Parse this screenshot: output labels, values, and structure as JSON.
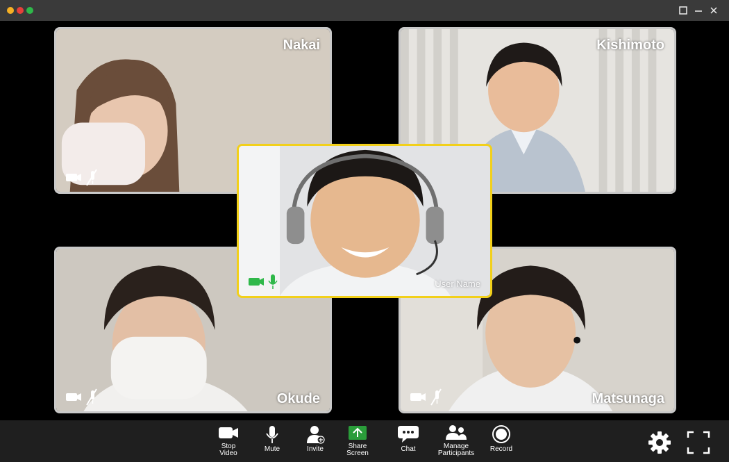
{
  "window": {
    "traffic_lights": [
      "#f6b024",
      "#e6403a",
      "#2fb84a"
    ]
  },
  "participants": {
    "nakai": {
      "name": "Nakai",
      "video": "off",
      "mic": "muted"
    },
    "kishimoto": {
      "name": "Kishimoto"
    },
    "speaker": {
      "name": "User Name",
      "video": "on",
      "mic": "on",
      "highlight": "#f2d01a"
    },
    "okude": {
      "name": "Okude",
      "video": "off",
      "mic": "muted"
    },
    "matsunaga": {
      "name": "Matsunaga",
      "video": "off",
      "mic": "muted"
    }
  },
  "toolbar": {
    "stop_video": "Stop\nVideo",
    "mute": "Mute",
    "invite": "Invite",
    "share_screen": "Share\nScreen",
    "chat": "Chat",
    "manage_participants": "Manage\nParticipants",
    "record": "Record",
    "share_color": "#2a9d3a"
  }
}
